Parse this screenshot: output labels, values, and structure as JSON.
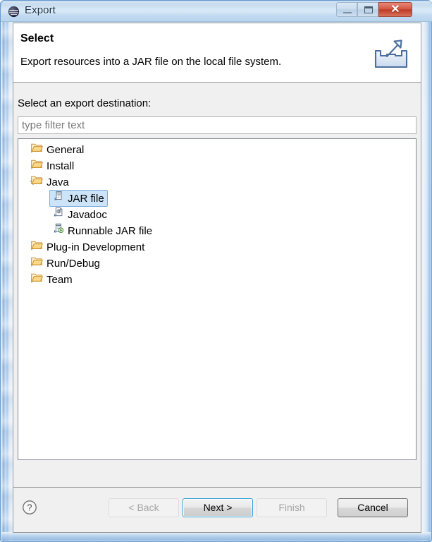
{
  "window": {
    "title": "Export",
    "app_icon": "eclipse-icon",
    "controls": {
      "minimize_label": "–",
      "maximize_label": "□",
      "close_label": "✕"
    },
    "colors": {
      "titlebar_gradient_top": "#b9d3ec",
      "titlebar_gradient_mid": "#d8e9f8",
      "close_button": "#bd3b27",
      "frame_border": "#6a9bd0",
      "selection_fill": "#cde3f7",
      "selection_border": "#7aacdc",
      "default_button_border": "#2f9ed1",
      "folder_icon": "#f5c96a",
      "body_background": "#f0f0f0"
    }
  },
  "header": {
    "title": "Select",
    "description": "Export resources into a JAR file on the local file system.",
    "icon": "export-wizard-icon"
  },
  "main": {
    "destination_label": "Select an export destination:",
    "filter": {
      "value": "",
      "placeholder": "type filter text"
    },
    "tree": [
      {
        "label": "General",
        "depth": 0,
        "icon": "folder-icon",
        "expanded": false,
        "has_children": true,
        "selected": false
      },
      {
        "label": "Install",
        "depth": 0,
        "icon": "folder-icon",
        "expanded": false,
        "has_children": true,
        "selected": false
      },
      {
        "label": "Java",
        "depth": 0,
        "icon": "folder-icon",
        "expanded": true,
        "has_children": true,
        "selected": false
      },
      {
        "label": "JAR file",
        "depth": 1,
        "icon": "jar-file-icon",
        "expanded": false,
        "has_children": false,
        "selected": true
      },
      {
        "label": "Javadoc",
        "depth": 1,
        "icon": "javadoc-icon",
        "expanded": false,
        "has_children": false,
        "selected": false
      },
      {
        "label": "Runnable JAR file",
        "depth": 1,
        "icon": "runnable-jar-icon",
        "expanded": false,
        "has_children": false,
        "selected": false
      },
      {
        "label": "Plug-in Development",
        "depth": 0,
        "icon": "folder-icon",
        "expanded": false,
        "has_children": true,
        "selected": false
      },
      {
        "label": "Run/Debug",
        "depth": 0,
        "icon": "folder-icon",
        "expanded": false,
        "has_children": true,
        "selected": false
      },
      {
        "label": "Team",
        "depth": 0,
        "icon": "folder-icon",
        "expanded": false,
        "has_children": true,
        "selected": false
      }
    ]
  },
  "footer": {
    "help_icon": "help-question-icon",
    "buttons": {
      "back": {
        "label": "< Back",
        "enabled": false,
        "default": false
      },
      "next": {
        "label": "Next >",
        "enabled": true,
        "default": true
      },
      "finish": {
        "label": "Finish",
        "enabled": false,
        "default": false
      },
      "cancel": {
        "label": "Cancel",
        "enabled": true,
        "default": false
      }
    }
  }
}
